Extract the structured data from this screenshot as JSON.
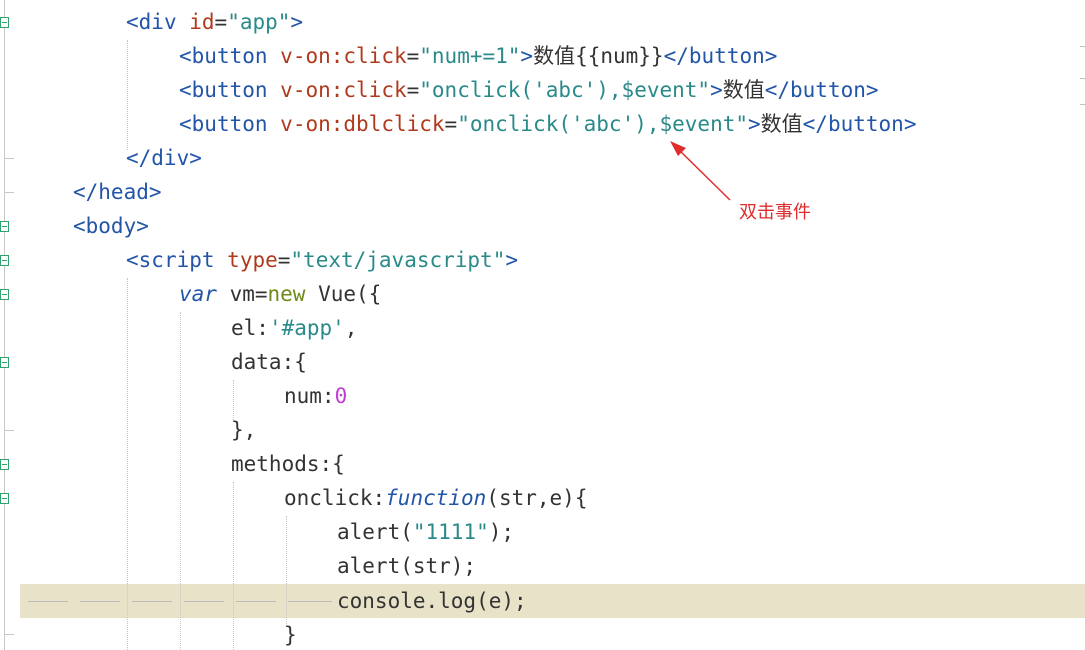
{
  "annotation": {
    "label": "双击事件",
    "color": "#e02c2c"
  },
  "colors": {
    "tag": "#2255a8",
    "attribute": "#b03a1e",
    "string": "#2a8a8a",
    "number": "#c23cd6",
    "highlight_line": "#e8e2c8",
    "fold_marker": "#2fa36b"
  },
  "code": {
    "l1": {
      "open": "<",
      "tag": "div",
      "sp": " ",
      "attr": "id",
      "eq": "=",
      "val": "\"app\"",
      "close": ">"
    },
    "l2": {
      "open": "<",
      "tag": "button",
      "sp": " ",
      "attr": "v-on:click",
      "eq": "=",
      "val": "\"num+=1\"",
      "gt": ">",
      "text": "数值{{num}}",
      "end": "</",
      "endtag": "button",
      "endgt": ">"
    },
    "l3": {
      "open": "<",
      "tag": "button",
      "sp": " ",
      "attr": "v-on:click",
      "eq": "=",
      "val": "\"onclick('abc'),$event\"",
      "gt": ">",
      "text": "数值",
      "end": "</",
      "endtag": "button",
      "endgt": ">"
    },
    "l4": {
      "open": "<",
      "tag": "button",
      "sp": " ",
      "attr": "v-on:dblclick",
      "eq": "=",
      "val": "\"onclick('abc'),$event\"",
      "gt": ">",
      "text": "数值",
      "end": "</",
      "endtag": "button",
      "endgt": ">"
    },
    "l5": {
      "text": "</div>"
    },
    "l6": {
      "text": "</head>"
    },
    "l7": {
      "text": "<body>"
    },
    "l8": {
      "open": "<",
      "tag": "script",
      "sp": " ",
      "attr": "type",
      "eq": "=",
      "val": "\"text/javascript\"",
      "close": ">"
    },
    "l9": {
      "kw": "var",
      "mid": " vm=",
      "new": "new",
      "rest": " Vue({"
    },
    "l10": {
      "key": "el:",
      "val": "'#app'",
      "rest": ","
    },
    "l11": {
      "text": "data:{"
    },
    "l12": {
      "key": "num:",
      "num": "0"
    },
    "l13": {
      "text": "},"
    },
    "l14": {
      "text": "methods:{"
    },
    "l15": {
      "key": "onclick:",
      "fn": "function",
      "rest": "(str,e){"
    },
    "l16": {
      "pre": "alert(",
      "str": "\"1111\"",
      "post": ");"
    },
    "l17": {
      "text": "alert(str);"
    },
    "l18": {
      "text": "console.log(e);"
    },
    "l19": {
      "text": "}"
    }
  }
}
